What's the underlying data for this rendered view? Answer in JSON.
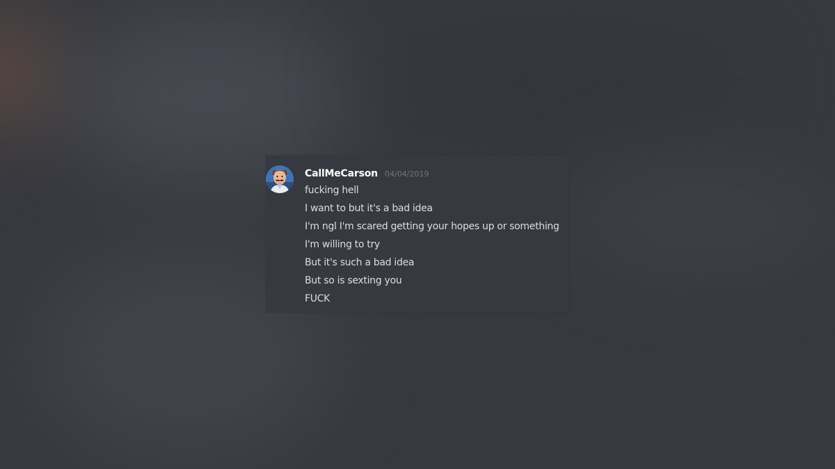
{
  "message": {
    "author": "CallMeCarson",
    "timestamp": "04/04/2019",
    "avatar_icon": "user-avatar-photo",
    "lines": [
      "fucking hell",
      "I want to but it's a bad idea",
      "I'm ngl I'm scared getting your hopes up or something",
      "I'm willing to try",
      "But it's such a bad idea",
      "But so is sexting you",
      "FUCK"
    ]
  },
  "colors": {
    "background": "#37393e",
    "card": "#36393f",
    "username": "#ffffff",
    "text": "#dcddde",
    "timestamp": "#72767d"
  }
}
